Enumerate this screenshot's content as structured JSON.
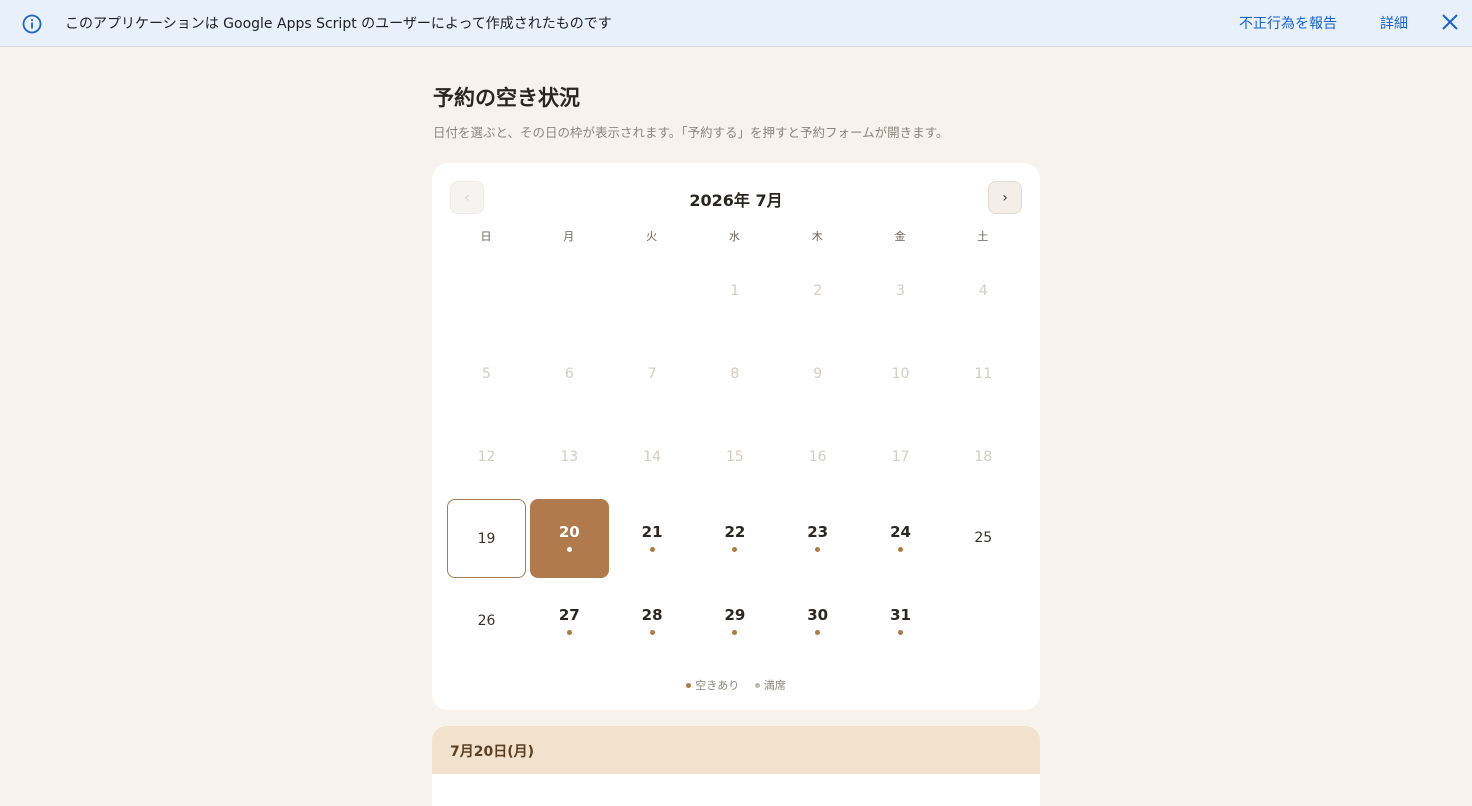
{
  "banner": {
    "message": "このアプリケーションは Google Apps Script のユーザーによって作成されたものです",
    "report_label": "不正行為を報告",
    "detail_label": "詳細"
  },
  "page": {
    "title": "予約の空き状況",
    "subtitle": "日付を選ぶと、その日の枠が表示されます。「予約する」を押すと予約フォームが開きます。"
  },
  "calendar": {
    "prev_label": "‹",
    "next_label": "›",
    "month_title": "2026年 7月",
    "weekdays": [
      "日",
      "月",
      "火",
      "水",
      "木",
      "金",
      "土"
    ],
    "first_weekday": 3,
    "days": [
      {
        "day": "1",
        "status": "past"
      },
      {
        "day": "2",
        "status": "past"
      },
      {
        "day": "3",
        "status": "past"
      },
      {
        "day": "4",
        "status": "past"
      },
      {
        "day": "5",
        "status": "past"
      },
      {
        "day": "6",
        "status": "past"
      },
      {
        "day": "7",
        "status": "past"
      },
      {
        "day": "8",
        "status": "past"
      },
      {
        "day": "9",
        "status": "past"
      },
      {
        "day": "10",
        "status": "past"
      },
      {
        "day": "11",
        "status": "past"
      },
      {
        "day": "12",
        "status": "past"
      },
      {
        "day": "13",
        "status": "past"
      },
      {
        "day": "14",
        "status": "past"
      },
      {
        "day": "15",
        "status": "past"
      },
      {
        "day": "16",
        "status": "past"
      },
      {
        "day": "17",
        "status": "past"
      },
      {
        "day": "18",
        "status": "past"
      },
      {
        "day": "19",
        "status": "today"
      },
      {
        "day": "20",
        "status": "selected"
      },
      {
        "day": "21",
        "status": "available"
      },
      {
        "day": "22",
        "status": "available"
      },
      {
        "day": "23",
        "status": "available"
      },
      {
        "day": "24",
        "status": "available"
      },
      {
        "day": "25",
        "status": "full"
      },
      {
        "day": "26",
        "status": "full"
      },
      {
        "day": "27",
        "status": "available"
      },
      {
        "day": "28",
        "status": "available"
      },
      {
        "day": "29",
        "status": "available"
      },
      {
        "day": "30",
        "status": "available"
      },
      {
        "day": "31",
        "status": "available"
      }
    ],
    "legend": {
      "available_label": "空きあり",
      "full_label": "満席"
    }
  },
  "selected_day": {
    "label": "7月20日(月)"
  },
  "colors": {
    "accent": "#b07a4d",
    "background": "#f7f3ec",
    "banner_bg": "#e8f0fc",
    "link": "#1a63c7"
  },
  "icons": {
    "info": "info-icon",
    "close": "close-icon"
  }
}
